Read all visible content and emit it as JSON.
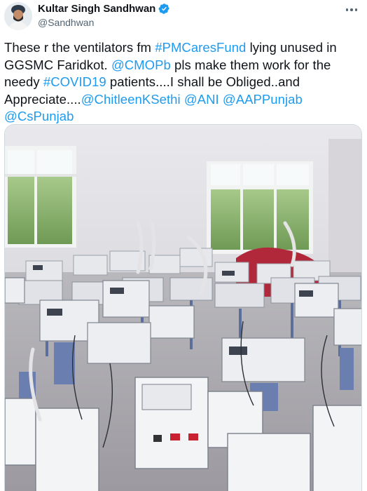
{
  "author": {
    "display_name": "Kultar Singh Sandhwan",
    "handle": "@Sandhwan",
    "verified": true,
    "avatar_icon": "person-avatar-icon"
  },
  "header": {
    "more_icon": "more-options-icon"
  },
  "tweet": {
    "lines": [
      [
        {
          "text": "These r the ventilators fm ",
          "link": false
        },
        {
          "text": "#PMCaresFund",
          "link": true
        },
        {
          "text": " lying unused in",
          "link": false
        }
      ],
      [
        {
          "text": "GGSMC Faridkot. ",
          "link": false
        },
        {
          "text": "@CMOPb",
          "link": true
        },
        {
          "text": " pls make them work for the",
          "link": false
        }
      ],
      [
        {
          "text": "needy ",
          "link": false
        },
        {
          "text": "#COVID19",
          "link": true
        },
        {
          "text": " patients....I shall be Obliged..and",
          "link": false
        }
      ],
      [
        {
          "text": "Appreciate....",
          "link": false
        },
        {
          "text": "@ChitleenKSethi",
          "link": true
        },
        {
          "text": " ",
          "link": false
        },
        {
          "text": "@ANI",
          "link": true
        },
        {
          "text": " ",
          "link": false
        },
        {
          "text": "@AAPPunjab",
          "link": true
        }
      ],
      [
        {
          "text": "@CsPunjab",
          "link": true
        }
      ]
    ]
  },
  "colors": {
    "link": "#1d9bf0",
    "text": "#0f1419",
    "secondary": "#536471",
    "verified": "#1d9bf0"
  },
  "media": {
    "alt_icon": "ventilators-photo"
  }
}
